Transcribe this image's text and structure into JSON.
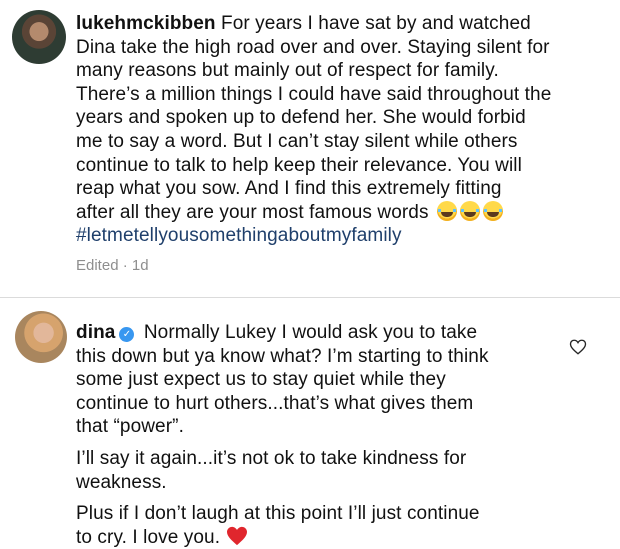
{
  "comments": [
    {
      "username": "lukehmckibben",
      "lines": [
        " For years I have sat by and watched",
        "Dina take the high road over and over.  Staying silent for",
        "many reasons but mainly out of respect for family.",
        "There’s a million things I could have said throughout the",
        "years and spoken up to defend her.  She would forbid",
        "me to say a word.  But I can’t stay silent while others",
        "continue to talk to help keep their relevance.  You will",
        "reap what you sow.  And I find this extremely fitting",
        "after all they are your most famous  words "
      ],
      "emoji_icon": "tears-of-joy-emoji",
      "emoji_count": 3,
      "hashtag": "#letmetellyousomethingaboutmyfamily",
      "meta": "Edited · 1d"
    },
    {
      "username": "dina",
      "verified_icon": "verified-badge-icon",
      "verified_color": "#3897f0",
      "paragraphs": [
        [
          " Normally Lukey I would ask you to take",
          "this down but ya know what? I’m starting to think",
          "some just expect us to stay quiet while they",
          "continue to hurt others...that’s what gives them",
          "that “power”."
        ],
        [
          "I’ll say it again...it’s not ok to take kindness for",
          "weakness."
        ],
        [
          "Plus if I don’t laugh at this point I’ll just continue",
          "to cry. I love you."
        ]
      ],
      "like_icon": "heart-outline-icon",
      "end_icon": "red-heart-emoji",
      "heart_color": "#e0262d"
    }
  ],
  "colors": {
    "hashtag": "#1f3f6b",
    "meta_text": "#8e8e8e",
    "divider": "#dbdbdb"
  }
}
